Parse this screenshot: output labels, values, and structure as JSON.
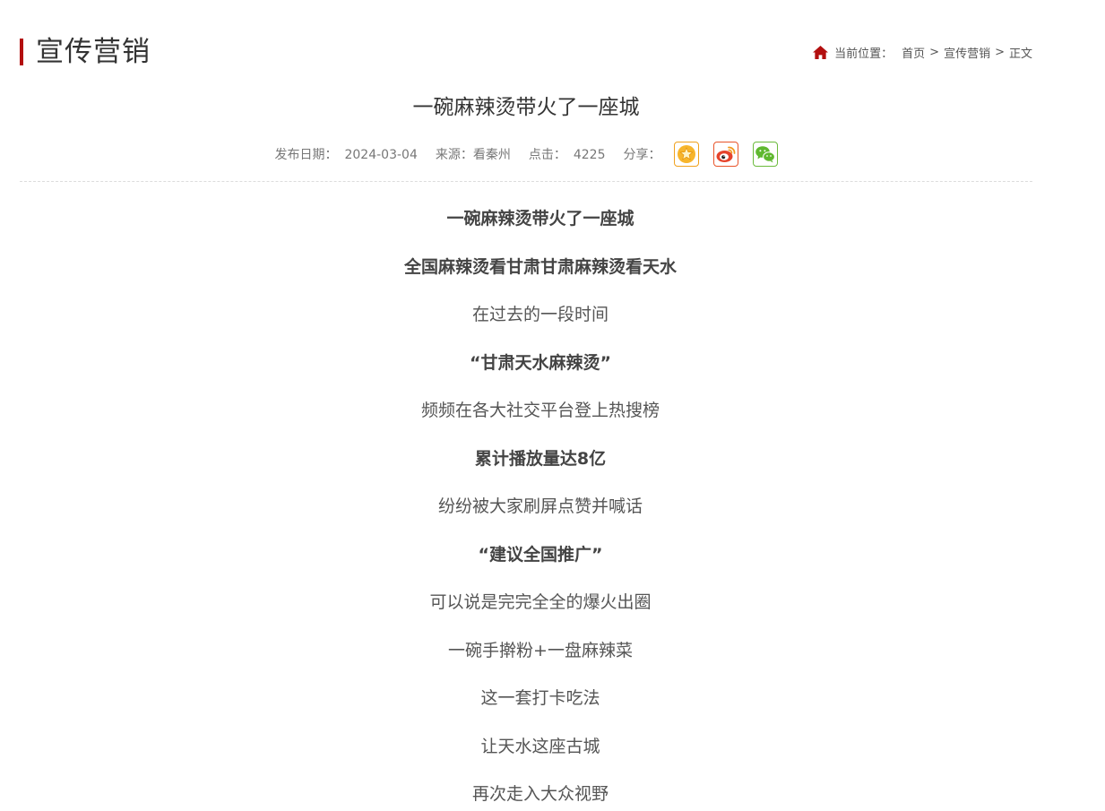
{
  "section": {
    "title": "宣传营销"
  },
  "breadcrumb": {
    "label": "当前位置：",
    "items": [
      "首页",
      "宣传营销",
      "正文"
    ],
    "separator": ">"
  },
  "article": {
    "title": "一碗麻辣烫带火了一座城",
    "meta": {
      "date_label": "发布日期：",
      "date": "2024-03-04",
      "source_label": "来源：",
      "source": "看秦州",
      "clicks_label": "点击：",
      "clicks": "4225",
      "share_label": "分享："
    },
    "paragraphs": [
      {
        "text": "一碗麻辣烫带火了一座城",
        "bold": true
      },
      {
        "text": "全国麻辣烫看甘肃甘肃麻辣烫看天水",
        "bold": true
      },
      {
        "text": "在过去的一段时间",
        "bold": false
      },
      {
        "text": "“甘肃天水麻辣烫”",
        "bold": true
      },
      {
        "text": "频频在各大社交平台登上热搜榜",
        "bold": false
      },
      {
        "text": "累计播放量达8亿",
        "bold": true
      },
      {
        "text": "纷纷被大家刷屏点赞并喊话",
        "bold": false
      },
      {
        "text": "“建议全国推广”",
        "bold": true
      },
      {
        "text": "可以说是完完全全的爆火出圈",
        "bold": false
      },
      {
        "text": "一碗手擀粉+一盘麻辣菜",
        "bold": false
      },
      {
        "text": "这一套打卡吃法",
        "bold": false
      },
      {
        "text": "让天水这座古城",
        "bold": false
      },
      {
        "text": "再次走入大众视野",
        "bold": false
      }
    ]
  },
  "colors": {
    "accent": "#b30f0f",
    "fav": "#f0a21e",
    "weibo": "#e8542a",
    "wechat": "#6cbb3c"
  },
  "icons": {
    "home": "home-icon",
    "share": [
      "favorite-star-icon",
      "weibo-icon",
      "wechat-icon"
    ]
  }
}
